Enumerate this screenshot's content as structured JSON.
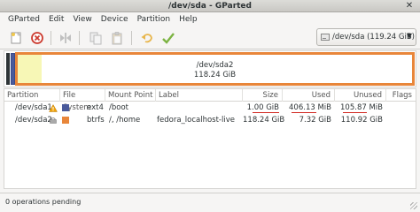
{
  "window": {
    "title": "/dev/sda - GParted"
  },
  "menu": [
    "GParted",
    "Edit",
    "View",
    "Device",
    "Partition",
    "Help"
  ],
  "toolbar": {
    "device_selector": "/dev/sda (119.24 GiB)"
  },
  "graph": {
    "partition_label": "/dev/sda2",
    "partition_size": "118.24 GiB"
  },
  "table": {
    "columns": [
      "Partition",
      "File System",
      "Mount Point",
      "Label",
      "Size",
      "Used",
      "Unused",
      "Flags"
    ],
    "rows": [
      {
        "partition": "/dev/sda1",
        "filesystem": "ext4",
        "mount": "/boot",
        "label": "",
        "size": "1.00 GiB",
        "used": "406.13 MiB",
        "unused": "105.87 MiB",
        "flags": ""
      },
      {
        "partition": "/dev/sda2",
        "filesystem": "btrfs",
        "mount": "/, /home",
        "label": "fedora_localhost-live",
        "size": "118.24 GiB",
        "used": "7.32 GiB",
        "unused": "110.92 GiB",
        "flags": ""
      }
    ]
  },
  "colors": {
    "ext4": "#4a5a9b",
    "btrfs": "#e8863a",
    "used_fill": "#f7f7b6",
    "underline": "#d0261f",
    "warning": "#f0a30a"
  },
  "status": {
    "text": "0 operations pending"
  }
}
